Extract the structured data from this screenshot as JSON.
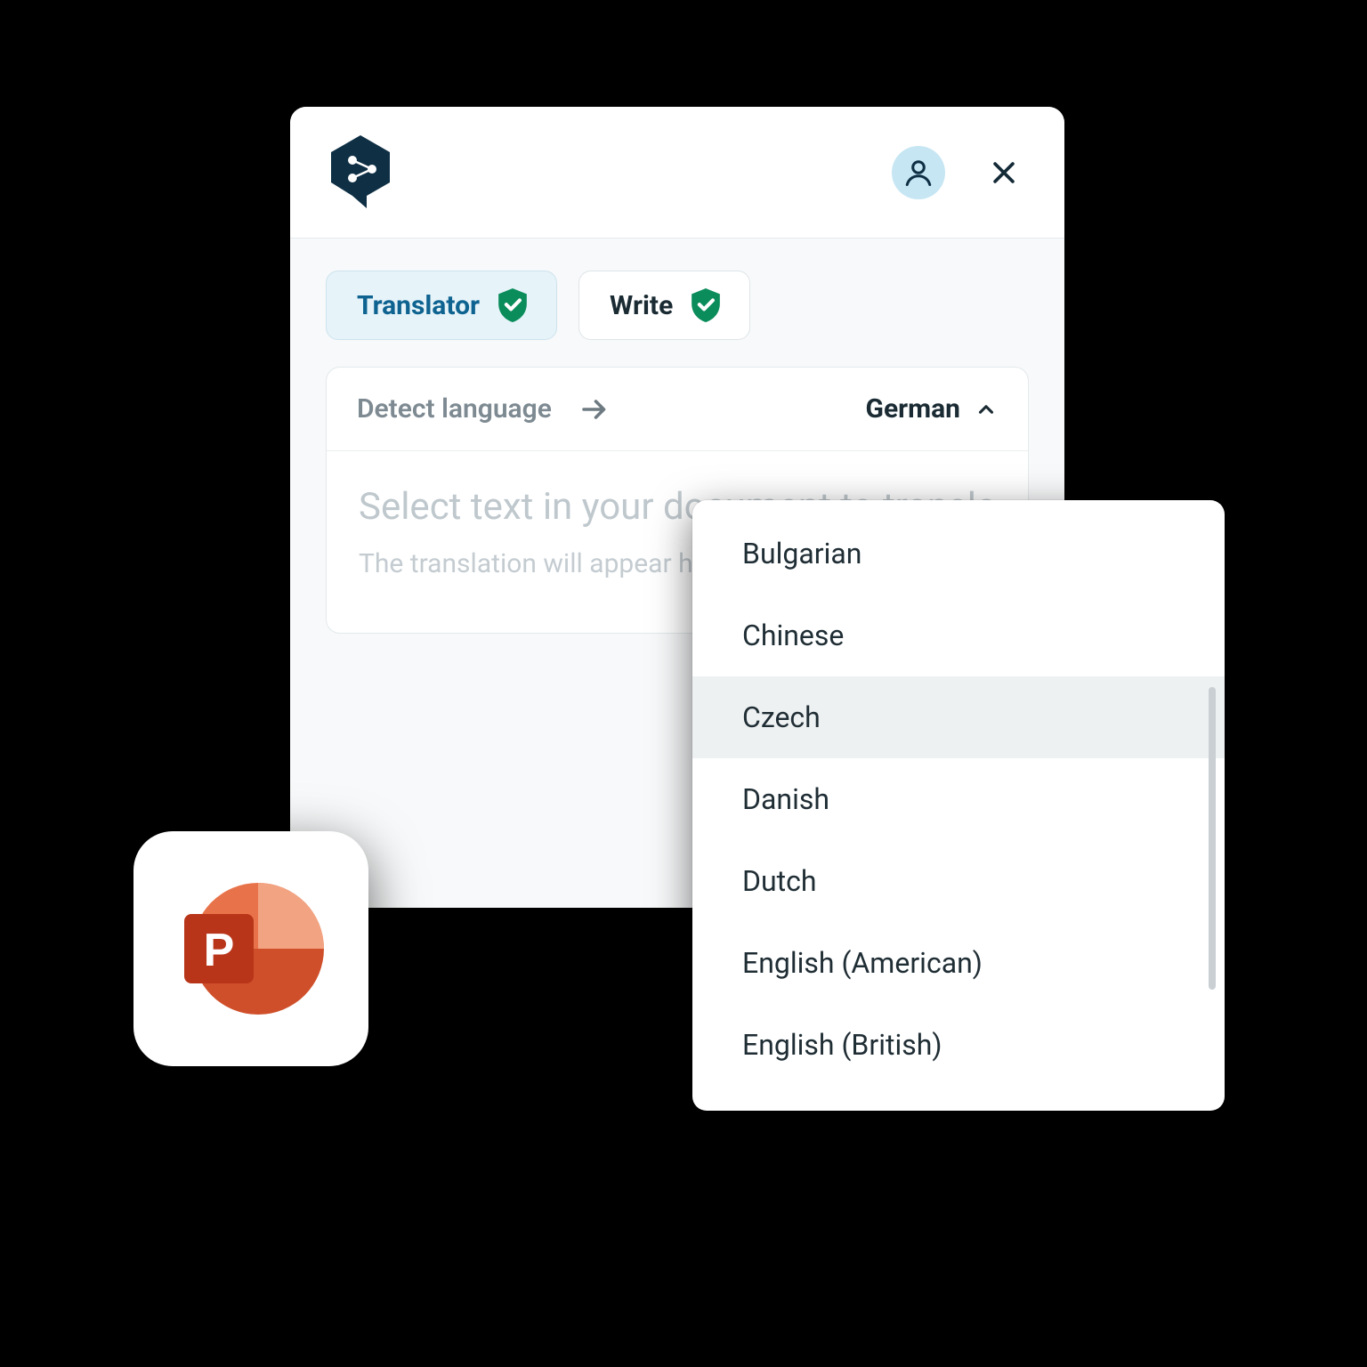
{
  "tabs": {
    "translator_label": "Translator",
    "write_label": "Write"
  },
  "lang_bar": {
    "detect_label": "Detect language",
    "target_label": "German"
  },
  "text_area": {
    "placeholder_main": "Select text in your document to translate",
    "placeholder_sub": "The translation will appear here"
  },
  "dropdown": {
    "items": [
      "Bulgarian",
      "Chinese",
      "Czech",
      "Danish",
      "Dutch",
      "English (American)",
      "English (British)"
    ],
    "highlighted_index": 2
  },
  "powerpoint_tile": {
    "letter": "P"
  },
  "colors": {
    "accent": "#0e6390",
    "shield": "#0a8c5b",
    "panel_bg": "#f7f9fa"
  }
}
